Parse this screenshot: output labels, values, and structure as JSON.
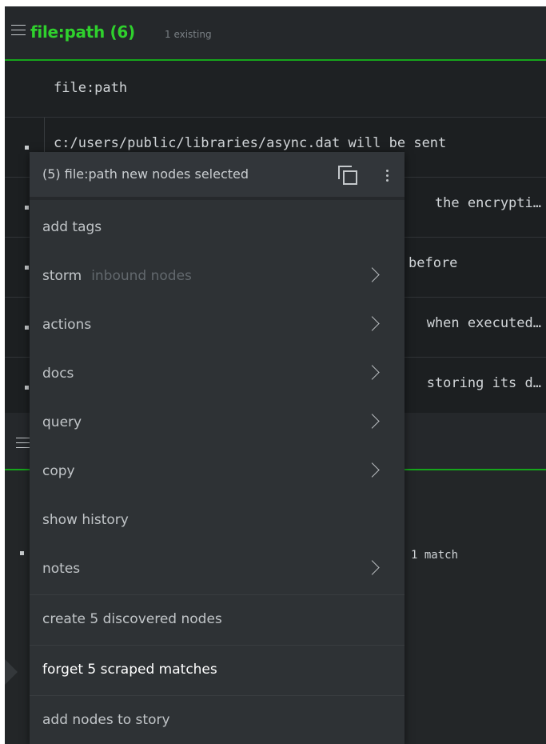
{
  "header": {
    "title": "file:path (6)",
    "subtitle": "1 existing"
  },
  "table": {
    "column": "file:path",
    "rows": [
      {
        "text": "c:/users/public/libraries/async.dat will be sent",
        "tail": ""
      },
      {
        "text": "",
        "tail": "the encrypti…"
      },
      {
        "text": "",
        "tail": "before"
      },
      {
        "text": "",
        "tail": "when executed…"
      },
      {
        "text": "",
        "tail": "storing its d…"
      }
    ]
  },
  "lower": {
    "match_text": "1 match"
  },
  "menu": {
    "title": "(5) file:path new nodes selected",
    "items": [
      {
        "label": "add tags",
        "sub": "",
        "submenu": false
      },
      {
        "label": "storm",
        "sub": "inbound nodes",
        "submenu": true
      },
      {
        "label": "actions",
        "sub": "",
        "submenu": true
      },
      {
        "label": "docs",
        "sub": "",
        "submenu": true
      },
      {
        "label": "query",
        "sub": "",
        "submenu": true
      },
      {
        "label": "copy",
        "sub": "",
        "submenu": true
      },
      {
        "label": "show history",
        "sub": "",
        "submenu": false
      },
      {
        "label": "notes",
        "sub": "",
        "submenu": true
      },
      {
        "label": "create 5 discovered nodes",
        "sub": "",
        "submenu": false
      },
      {
        "label": "forget 5 scraped matches",
        "sub": "",
        "submenu": false
      },
      {
        "label": "add nodes to story",
        "sub": "",
        "submenu": false
      }
    ]
  },
  "colors": {
    "accent": "#2fd12d",
    "background": "#232628",
    "menu_bg": "#2e3235"
  },
  "icons": {
    "menu": "hamburger-icon",
    "copy": "copy-icon",
    "more": "kebab-icon",
    "submenu": "chevron-right-icon"
  }
}
